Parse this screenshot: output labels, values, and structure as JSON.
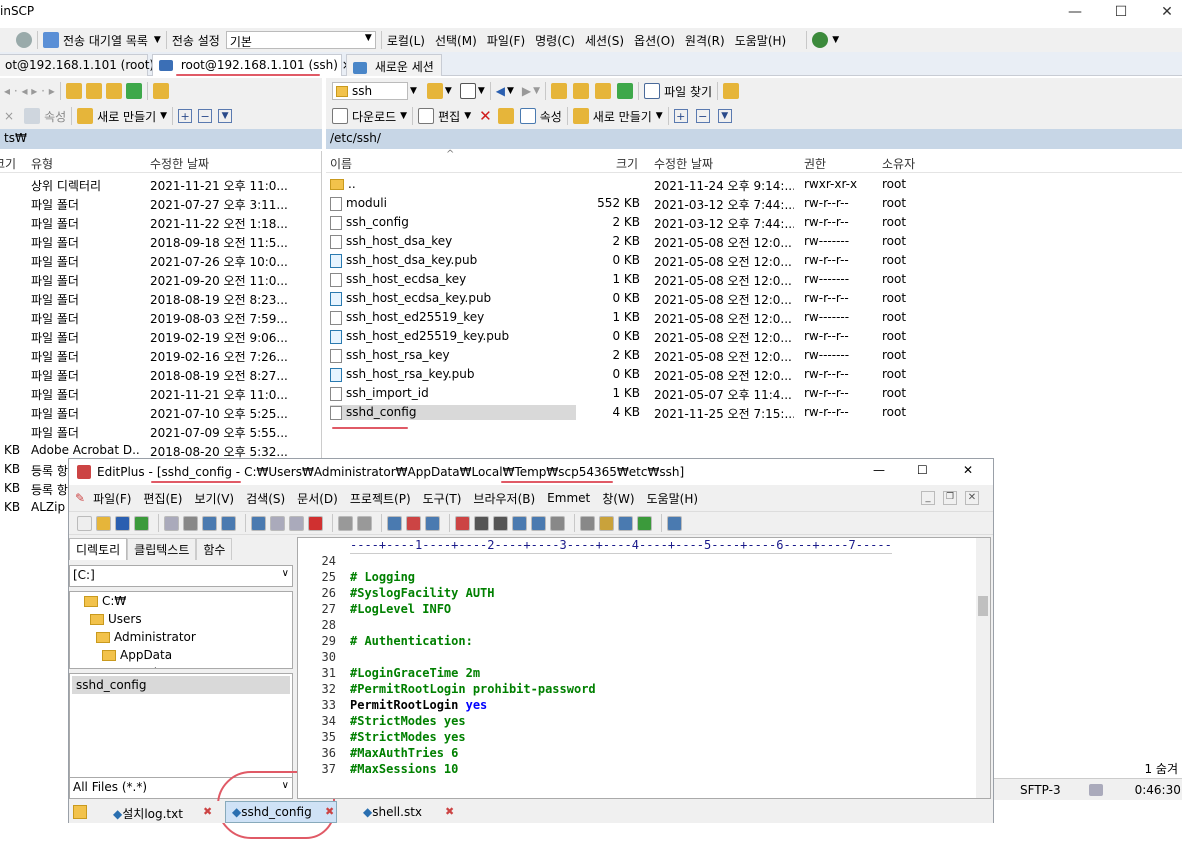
{
  "app": {
    "title": "inSCP"
  },
  "toolbar1": {
    "queue_label": "전송 대기열 목록",
    "transfer_label": "전송 설정",
    "transfer_value": "기본",
    "menus": [
      "로컬(L)",
      "선택(M)",
      "파일(F)",
      "명령(C)",
      "세션(S)",
      "옵션(O)",
      "원격(R)",
      "도움말(H)"
    ]
  },
  "tabs": [
    {
      "label": "ot@192.168.1.101 (root)",
      "close": "×"
    },
    {
      "label": "root@192.168.1.101 (ssh)",
      "close": "×"
    },
    {
      "label": "새로운 세션"
    }
  ],
  "left": {
    "toolbar": {
      "props": "속성",
      "new": "새로 만들기"
    },
    "path": "ts₩",
    "columns": [
      "크기",
      "유형",
      "수정한 날짜"
    ],
    "rows": [
      {
        "size": "",
        "type": "상위 디렉터리",
        "date": "2021-11-21  오후 11:0..."
      },
      {
        "size": "",
        "type": "파일 폴더",
        "date": "2021-07-27  오후 3:11..."
      },
      {
        "size": "",
        "type": "파일 폴더",
        "date": "2021-11-22  오전 1:18..."
      },
      {
        "size": "",
        "type": "파일 폴더",
        "date": "2018-09-18  오전 11:5..."
      },
      {
        "size": "",
        "type": "파일 폴더",
        "date": "2021-07-26  오후 10:0..."
      },
      {
        "size": "",
        "type": "파일 폴더",
        "date": "2021-09-20  오전 11:0..."
      },
      {
        "size": "",
        "type": "파일 폴더",
        "date": "2018-08-19  오전 8:23..."
      },
      {
        "size": "",
        "type": "파일 폴더",
        "date": "2019-08-03  오전 7:59..."
      },
      {
        "size": "",
        "type": "파일 폴더",
        "date": "2019-02-19  오전 9:06..."
      },
      {
        "size": "",
        "type": "파일 폴더",
        "date": "2019-02-16  오전 7:26..."
      },
      {
        "size": "",
        "type": "파일 폴더",
        "date": "2018-08-19  오전 8:27..."
      },
      {
        "size": "",
        "type": "파일 폴더",
        "date": "2021-11-21  오후 11:0..."
      },
      {
        "size": "",
        "type": "파일 폴더",
        "date": "2021-07-10  오후 5:25..."
      },
      {
        "size": "",
        "type": "파일 폴더",
        "date": "2021-07-09  오후 5:55..."
      },
      {
        "size": "KB",
        "type": "Adobe Acrobat D...",
        "date": "2018-08-20  오후 5:32..."
      },
      {
        "size": "KB",
        "type": "등록 항",
        "date": ""
      },
      {
        "size": "KB",
        "type": "등록 항",
        "date": ""
      },
      {
        "size": "KB",
        "type": "ALZip",
        "date": ""
      }
    ]
  },
  "right": {
    "dir_name": "ssh",
    "toolbar2": {
      "find": "파일 찾기"
    },
    "toolbar3": {
      "download": "다운로드",
      "edit": "편집",
      "props": "속성",
      "new": "새로 만들기"
    },
    "path": "/etc/ssh/",
    "columns": [
      "이름",
      "크기",
      "수정한 날짜",
      "권한",
      "소유자"
    ],
    "rows": [
      {
        "name": "..",
        "icon": "folder",
        "size": "",
        "date": "2021-11-24  오후 9:14:...",
        "perm": "rwxr-xr-x",
        "owner": "root"
      },
      {
        "name": "moduli",
        "icon": "file",
        "size": "552 KB",
        "date": "2021-03-12  오후 7:44:...",
        "perm": "rw-r--r--",
        "owner": "root"
      },
      {
        "name": "ssh_config",
        "icon": "file",
        "size": "2 KB",
        "date": "2021-03-12  오후 7:44:...",
        "perm": "rw-r--r--",
        "owner": "root"
      },
      {
        "name": "ssh_host_dsa_key",
        "icon": "file",
        "size": "2 KB",
        "date": "2021-05-08  오전 12:0...",
        "perm": "rw-------",
        "owner": "root"
      },
      {
        "name": "ssh_host_dsa_key.pub",
        "icon": "pub",
        "size": "0 KB",
        "date": "2021-05-08  오전 12:0...",
        "perm": "rw-r--r--",
        "owner": "root"
      },
      {
        "name": "ssh_host_ecdsa_key",
        "icon": "file",
        "size": "1 KB",
        "date": "2021-05-08  오전 12:0...",
        "perm": "rw-------",
        "owner": "root"
      },
      {
        "name": "ssh_host_ecdsa_key.pub",
        "icon": "pub",
        "size": "0 KB",
        "date": "2021-05-08  오전 12:0...",
        "perm": "rw-r--r--",
        "owner": "root"
      },
      {
        "name": "ssh_host_ed25519_key",
        "icon": "file",
        "size": "1 KB",
        "date": "2021-05-08  오전 12:0...",
        "perm": "rw-------",
        "owner": "root"
      },
      {
        "name": "ssh_host_ed25519_key.pub",
        "icon": "pub",
        "size": "0 KB",
        "date": "2021-05-08  오전 12:0...",
        "perm": "rw-r--r--",
        "owner": "root"
      },
      {
        "name": "ssh_host_rsa_key",
        "icon": "file",
        "size": "2 KB",
        "date": "2021-05-08  오전 12:0...",
        "perm": "rw-------",
        "owner": "root"
      },
      {
        "name": "ssh_host_rsa_key.pub",
        "icon": "pub",
        "size": "0 KB",
        "date": "2021-05-08  오전 12:0...",
        "perm": "rw-r--r--",
        "owner": "root"
      },
      {
        "name": "ssh_import_id",
        "icon": "file",
        "size": "1 KB",
        "date": "2021-05-07  오후 11:4...",
        "perm": "rw-r--r--",
        "owner": "root"
      },
      {
        "name": "sshd_config",
        "icon": "file",
        "size": "4 KB",
        "date": "2021-11-25  오전 7:15:...",
        "perm": "rw-r--r--",
        "owner": "root",
        "selected": true
      }
    ]
  },
  "status": {
    "right_text": "1 숨겨",
    "protocol": "SFTP-3",
    "time": "0:46:30"
  },
  "editplus": {
    "title_app": "EditPlus - ",
    "title_file": "[sshd_config - ",
    "title_path": "C:₩Users₩Administrator₩AppData₩Local₩Temp₩scp54365₩etc₩ssh]",
    "menus": [
      "파일(F)",
      "편집(E)",
      "보기(V)",
      "검색(S)",
      "문서(D)",
      "프로젝트(P)",
      "도구(T)",
      "브라우저(B)",
      "Emmet",
      "창(W)",
      "도움말(H)"
    ],
    "side_tabs": [
      "디렉토리",
      "클립텍스트",
      "함수"
    ],
    "drive": "[C:]",
    "tree": [
      "C:₩",
      "Users",
      "Administrator",
      "AppData",
      "Local"
    ],
    "open_file": "sshd_config",
    "filter": "All Files (*.*)",
    "ruler": "----+----1----+----2----+----3----+----4----+----5----+----6----+----7-----",
    "lines": [
      {
        "n": "24",
        "parts": []
      },
      {
        "n": "25",
        "parts": [
          {
            "c": "cm",
            "t": "# Logging"
          }
        ]
      },
      {
        "n": "26",
        "parts": [
          {
            "c": "cm",
            "t": "#SyslogFacility AUTH"
          }
        ]
      },
      {
        "n": "27",
        "parts": [
          {
            "c": "cm",
            "t": "#LogLevel INFO"
          }
        ]
      },
      {
        "n": "28",
        "parts": []
      },
      {
        "n": "29",
        "parts": [
          {
            "c": "cm",
            "t": "# Authentication:"
          }
        ]
      },
      {
        "n": "30",
        "parts": []
      },
      {
        "n": "31",
        "parts": [
          {
            "c": "cm",
            "t": "#LoginGraceTime 2m"
          }
        ]
      },
      {
        "n": "32",
        "parts": [
          {
            "c": "cm",
            "t": "#PermitRootLogin prohibit-password"
          }
        ]
      },
      {
        "n": "33",
        "parts": [
          {
            "c": "pl",
            "t": "PermitRootLogin "
          },
          {
            "c": "kw",
            "t": "yes"
          }
        ]
      },
      {
        "n": "34",
        "parts": [
          {
            "c": "cm",
            "t": "#StrictModes yes"
          }
        ]
      },
      {
        "n": "35",
        "parts": [
          {
            "c": "cm",
            "t": "#StrictModes yes"
          }
        ]
      },
      {
        "n": "36",
        "parts": [
          {
            "c": "cm",
            "t": "#MaxAuthTries 6"
          }
        ]
      },
      {
        "n": "37",
        "parts": [
          {
            "c": "cm",
            "t": "#MaxSessions 10"
          }
        ]
      }
    ],
    "doc_tabs": [
      {
        "label": "설치log.txt"
      },
      {
        "label": "sshd_config"
      },
      {
        "label": "shell.stx"
      }
    ],
    "win_controls": [
      "—",
      "☐",
      "✕"
    ]
  }
}
